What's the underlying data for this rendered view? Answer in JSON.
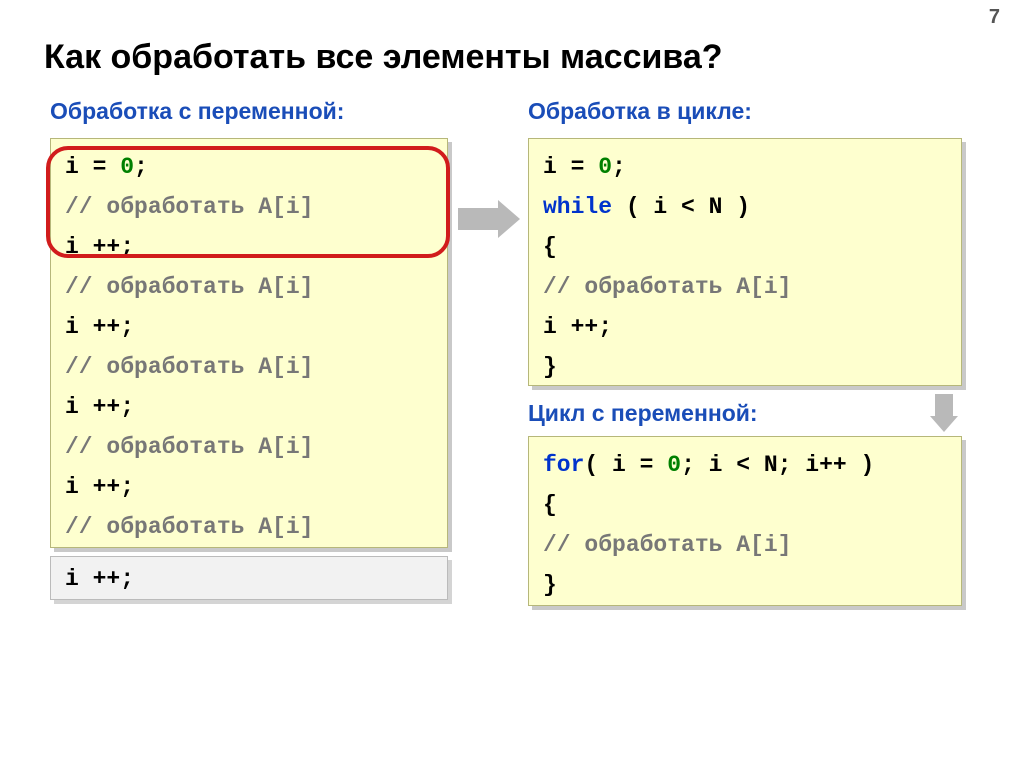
{
  "page_number": "7",
  "title": "Как обработать все элементы массива?",
  "subtitles": {
    "left": "Обработка с переменной:",
    "right_top": "Обработка в цикле:",
    "right_bottom": "Цикл с переменной:"
  },
  "left_box": {
    "l1_a": "i = ",
    "l1_num": "0",
    "l1_b": ";",
    "comment": "// обработать A[i]",
    "inc": "i ++;"
  },
  "right_top_box": {
    "l1_a": "i = ",
    "l1_num": "0",
    "l1_b": ";",
    "kw": "while",
    "cond": " ( i < N )",
    "brace_open": "   {",
    "comment": "   // обработать A[i]",
    "inc": "   i ++;",
    "brace_close": "   }"
  },
  "right_bottom_box": {
    "kw": "for",
    "head_a": "( i = ",
    "head_num": "0",
    "head_b": "; i < N; i++ )",
    "brace_open": "   {",
    "comment": "   // обработать A[i]",
    "brace_close": "   }"
  },
  "extra_box": {
    "inc": "i ++;"
  }
}
